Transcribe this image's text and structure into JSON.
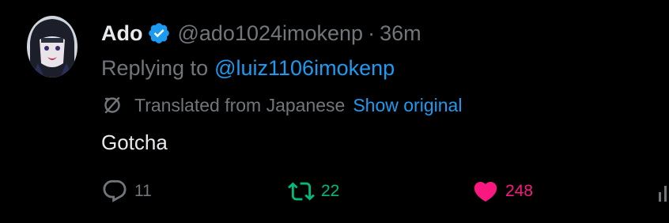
{
  "tweet": {
    "author_name": "Ado",
    "handle": "@ado1024imokenp",
    "separator": "·",
    "timestamp": "36m",
    "replying_prefix": "Replying to",
    "replying_to": "@luiz1106imokenp",
    "translated_label": "Translated from Japanese",
    "show_original_label": "Show original",
    "text": "Gotcha"
  },
  "actions": {
    "replies": "11",
    "retweets": "22",
    "likes": "248"
  },
  "colors": {
    "background": "#000000",
    "primary_text": "#e7e9ea",
    "secondary_text": "#71767b",
    "link": "#1d9bf0",
    "retweet_active": "#00ba7c",
    "like_active": "#f91880"
  },
  "icons": {
    "verified": "verified-badge-icon",
    "translate": "translate-icon",
    "reply": "reply-icon",
    "retweet": "retweet-icon",
    "like": "heart-icon",
    "views": "views-icon"
  }
}
